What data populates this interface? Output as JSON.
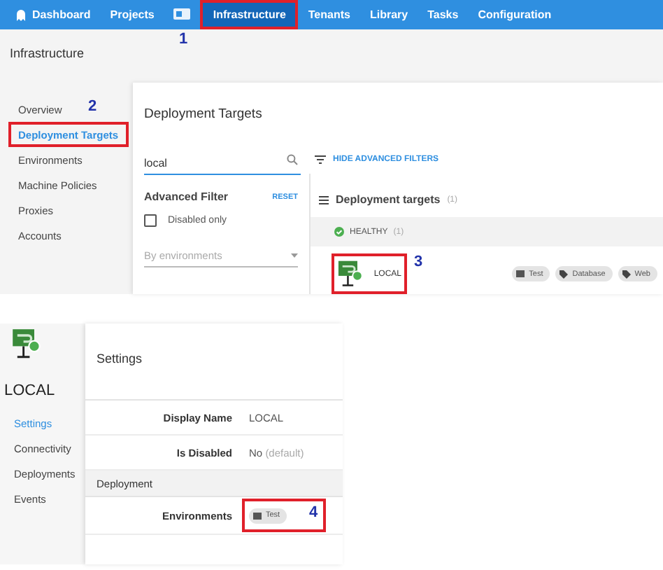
{
  "nav": {
    "items": [
      {
        "kind": "logo",
        "label": "Dashboard",
        "selected": false,
        "highlighted": false
      },
      {
        "kind": "text",
        "label": "Projects",
        "selected": false,
        "highlighted": false
      },
      {
        "kind": "icon",
        "selected": false,
        "highlighted": false
      },
      {
        "kind": "text",
        "label": "Infrastructure",
        "selected": true,
        "highlighted": true
      },
      {
        "kind": "text",
        "label": "Tenants",
        "selected": false,
        "highlighted": false
      },
      {
        "kind": "text",
        "label": "Library",
        "selected": false,
        "highlighted": false
      },
      {
        "kind": "text",
        "label": "Tasks",
        "selected": false,
        "highlighted": false
      },
      {
        "kind": "text",
        "label": "Configuration",
        "selected": false,
        "highlighted": false
      }
    ]
  },
  "page_title": "Infrastructure",
  "sidebar": {
    "items": [
      {
        "label": "Overview",
        "selected": false,
        "highlighted": false
      },
      {
        "label": "Deployment Targets",
        "selected": true,
        "highlighted": true
      },
      {
        "label": "Environments",
        "selected": false,
        "highlighted": false
      },
      {
        "label": "Machine Policies",
        "selected": false,
        "highlighted": false
      },
      {
        "label": "Proxies",
        "selected": false,
        "highlighted": false
      },
      {
        "label": "Accounts",
        "selected": false,
        "highlighted": false
      }
    ]
  },
  "main": {
    "title": "Deployment Targets",
    "search": {
      "value": "local"
    },
    "filter_toggle": "HIDE ADVANCED FILTERS",
    "advanced_filter": {
      "title": "Advanced Filter",
      "reset": "RESET",
      "checkbox": {
        "label": "Disabled only",
        "checked": false
      },
      "dropdown": {
        "placeholder": "By environments"
      }
    },
    "targets": {
      "title": "Deployment targets",
      "count": "(1)",
      "groups": [
        {
          "status": "HEALTHY",
          "count": "(1)",
          "items": [
            {
              "name": "LOCAL",
              "highlighted": true,
              "tags": [
                {
                  "kind": "environment",
                  "label": "Test"
                },
                {
                  "kind": "role",
                  "label": "Database"
                },
                {
                  "kind": "role",
                  "label": "Web"
                }
              ]
            }
          ]
        }
      ]
    }
  },
  "detail": {
    "name": "LOCAL",
    "nav": [
      {
        "label": "Settings",
        "selected": true
      },
      {
        "label": "Connectivity",
        "selected": false
      },
      {
        "label": "Deployments",
        "selected": false
      },
      {
        "label": "Events",
        "selected": false
      }
    ],
    "section_title": "Settings",
    "rows": [
      {
        "kind": "field",
        "label": "Display Name",
        "value": "LOCAL"
      },
      {
        "kind": "field",
        "label": "Is Disabled",
        "value": "No",
        "note": "(default)"
      },
      {
        "kind": "section",
        "label": "Deployment"
      },
      {
        "kind": "tags",
        "label": "Environments",
        "highlighted": true,
        "tags": [
          {
            "kind": "environment",
            "label": "Test"
          }
        ]
      }
    ]
  },
  "annotations": [
    "1",
    "2",
    "3",
    "4"
  ]
}
